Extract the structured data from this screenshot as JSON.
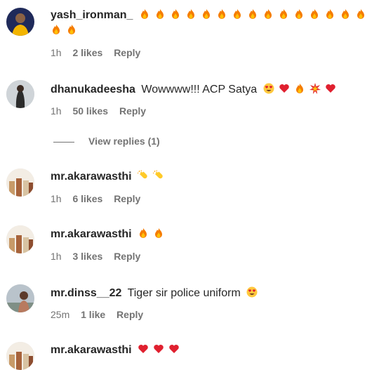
{
  "comments": [
    {
      "username": "yash_ironman_",
      "text": "",
      "emojis": [
        "fire",
        "fire",
        "fire",
        "fire",
        "fire",
        "fire",
        "fire",
        "fire",
        "fire",
        "fire",
        "fire",
        "fire",
        "fire",
        "fire",
        "fire",
        "fire",
        "fire"
      ],
      "time": "1h",
      "likes": "2 likes",
      "reply": "Reply"
    },
    {
      "username": "dhanukadeesha",
      "text": "Wowwww!!! ACP Satya",
      "emojis": [
        "heart-eyes",
        "red-heart",
        "fire",
        "collision",
        "red-heart"
      ],
      "time": "1h",
      "likes": "50 likes",
      "reply": "Reply",
      "view_replies": "View replies (1)"
    },
    {
      "username": "mr.akarawasthi",
      "text": "",
      "emojis": [
        "clapping-hands",
        "clapping-hands"
      ],
      "time": "1h",
      "likes": "6 likes",
      "reply": "Reply"
    },
    {
      "username": "mr.akarawasthi",
      "text": "",
      "emojis": [
        "fire",
        "fire"
      ],
      "time": "1h",
      "likes": "3 likes",
      "reply": "Reply"
    },
    {
      "username": "mr.dinss__22",
      "text": "Tiger sir police uniform",
      "emojis": [
        "heart-eyes"
      ],
      "time": "25m",
      "likes": "1 like",
      "reply": "Reply"
    },
    {
      "username": "mr.akarawasthi",
      "text": "",
      "emojis": [
        "red-heart",
        "red-heart",
        "red-heart"
      ],
      "time": "",
      "likes": "",
      "reply": ""
    }
  ]
}
